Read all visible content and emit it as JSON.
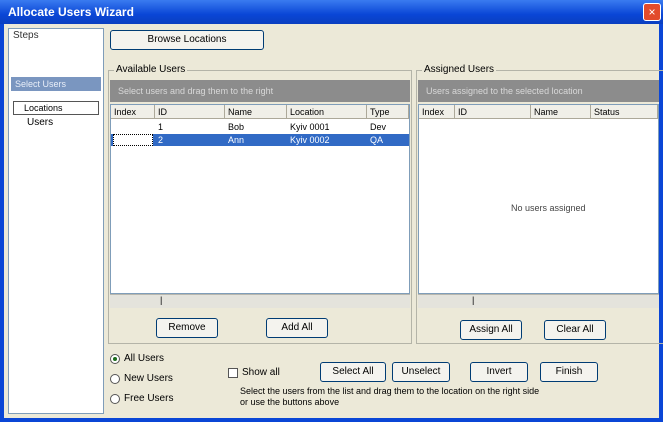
{
  "window": {
    "title": "Allocate Users Wizard",
    "close_glyph": "×"
  },
  "left_panel": {
    "label": "Steps",
    "highlight": "Select Users",
    "combo": "Locations",
    "item": "Users"
  },
  "top_button": "Browse Locations",
  "available": {
    "title": "Available Users",
    "band": "Select users and drag them to the right",
    "columns": [
      "Index",
      "ID",
      "Name",
      "Location",
      "Type"
    ],
    "rows": [
      {
        "cells": [
          "",
          "1",
          "Bob",
          "Kyiv 0001",
          "Dev"
        ],
        "selected": false
      },
      {
        "cells": [
          "",
          "2",
          "Ann",
          "Kyiv 0002",
          "QA"
        ],
        "selected": true
      }
    ],
    "scroll_mark": "|",
    "buttons": [
      "Remove",
      "Add All"
    ]
  },
  "assigned": {
    "title": "Assigned Users",
    "band": "Users assigned to the selected location",
    "columns": [
      "Index",
      "ID",
      "Name",
      "Status"
    ],
    "empty": "No users assigned",
    "scroll_mark": "|",
    "buttons": [
      "Assign All",
      "Clear All"
    ]
  },
  "options": {
    "radios": [
      {
        "label": "All Users",
        "checked": true
      },
      {
        "label": "New Users",
        "checked": false
      },
      {
        "label": "Free Users",
        "checked": false
      }
    ],
    "checkbox": "Show all",
    "buttons": [
      "Select All",
      "Unselect",
      "Invert",
      "Finish"
    ],
    "note_line1": "Select the users from the list and drag them to the location on the right side",
    "note_line2": "or use the buttons above"
  }
}
